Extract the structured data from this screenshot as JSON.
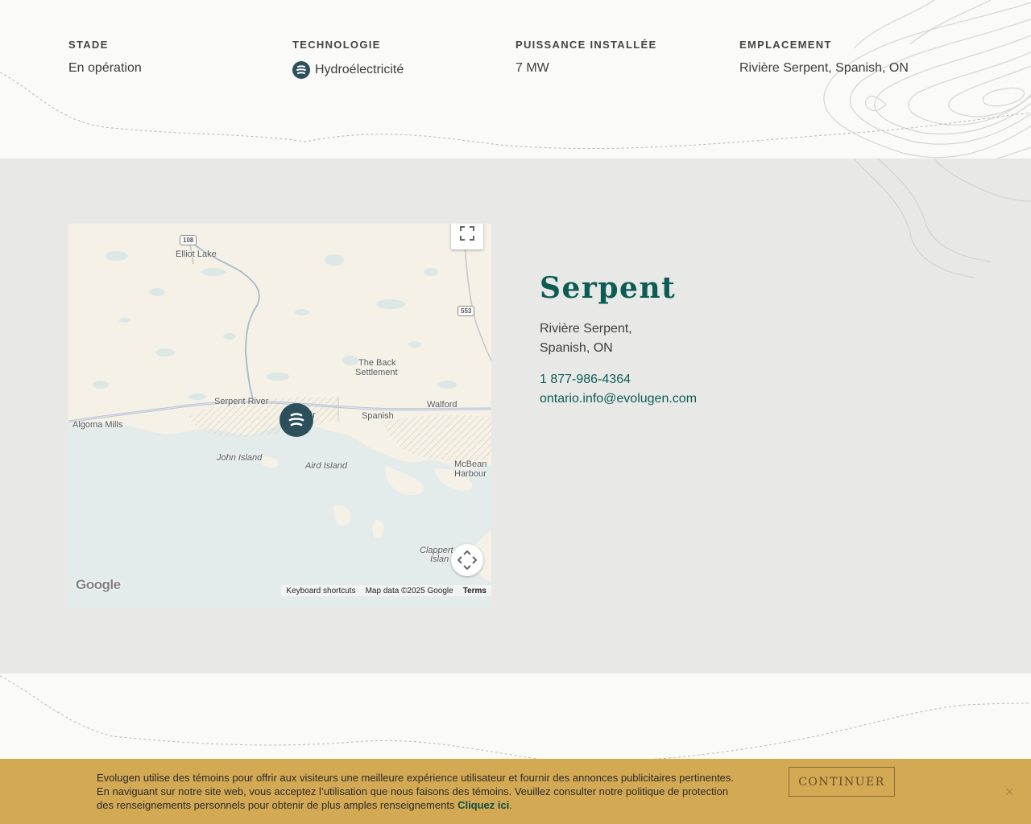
{
  "facts": [
    {
      "label": "STADE",
      "value": "En opération"
    },
    {
      "label": "TECHNOLOGIE",
      "value": "Hydroélectricité",
      "icon": "hydro-icon"
    },
    {
      "label": "PUISSANCE INSTALLÉE",
      "value": "7 MW"
    },
    {
      "label": "EMPLACEMENT",
      "value": "Rivière Serpent, Spanish, ON"
    }
  ],
  "map": {
    "labels": {
      "elliot_lake": "Elliot Lake",
      "back_settlement_1": "The Back",
      "back_settlement_2": "Settlement",
      "serpent_river": "Serpent River",
      "walford": "Walford",
      "spanish": "Spanish",
      "algoma_mills": "Algoma Mills",
      "john_island": "John Island",
      "aird_island": "Aird Island",
      "mcbean_1": "McBean",
      "mcbean_2": "Harbour",
      "clapperton_1": "Clappert",
      "clapperton_2": "Islan",
      "cutler": "er"
    },
    "highways": {
      "hwy108": "108",
      "hwy553": "553"
    },
    "logo": "Google",
    "attribution": {
      "shortcuts": "Keyboard shortcuts",
      "data": "Map data ©2025 Google",
      "terms": "Terms"
    }
  },
  "site": {
    "title": "Serpent",
    "address_line1": "Rivière Serpent,",
    "address_line2": "Spanish, ON",
    "phone": "1 877-986-4364",
    "email": "ontario.info@evolugen.com"
  },
  "cookie": {
    "line1": "Evolugen utilise des témoins pour offrir aux visiteurs une meilleure expérience utilisateur et fournir des annonces publicitaires pertinentes.",
    "line2": "En naviguant sur notre site web, vous acceptez l’utilisation que nous faisons des témoins. Veuillez consulter notre politique de protection",
    "line3": "des renseignements personnels pour obtenir de plus amples renseignements",
    "link": "Cliquez ici",
    "period": ".",
    "button": "CONTINUER",
    "close": "×"
  },
  "colors": {
    "brand_teal": "#0c5c55",
    "marker": "#2d4f5c",
    "band": "#e8e9e7",
    "cookie_bar": "#d4a953"
  }
}
